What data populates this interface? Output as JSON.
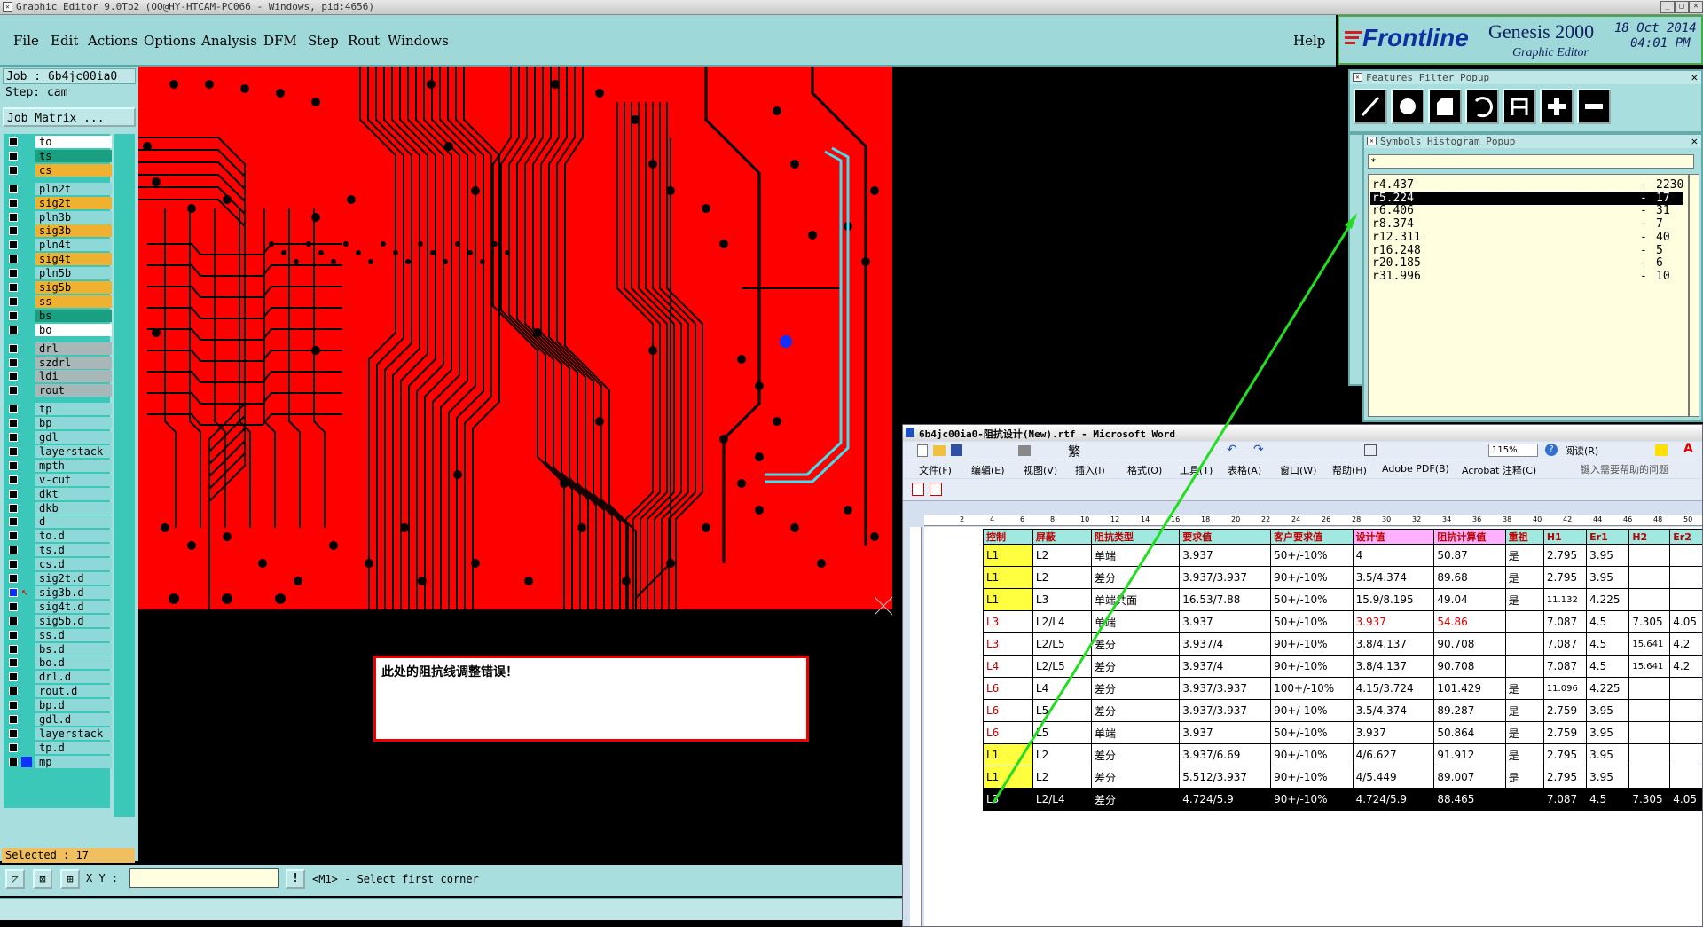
{
  "titlebar": {
    "title": "Graphic Editor 9.0Tb2  (OO@HY-HTCAM-PC066 - Windows, pid:4656)"
  },
  "menu": {
    "items": [
      "File",
      "Edit",
      "Actions",
      "Options",
      "Analysis",
      "DFM",
      "Step",
      "Rout",
      "Windows"
    ],
    "help": "Help"
  },
  "logo": {
    "brand": "Frontline",
    "product": "Genesis 2000",
    "subtitle": "Graphic Editor",
    "date": "18 Oct 2014",
    "time": "04:01 PM"
  },
  "job": {
    "job": "Job : 6b4jc00ia0",
    "step": "Step: cam",
    "matrix": "Job Matrix ..."
  },
  "layers": [
    {
      "name": "to",
      "color": "#ffffff"
    },
    {
      "name": "ts",
      "color": "#1aa080"
    },
    {
      "name": "cs",
      "color": "#f0b030"
    },
    {
      "name": "pln2t",
      "color": "#8ed8d8"
    },
    {
      "name": "sig2t",
      "color": "#f0b030"
    },
    {
      "name": "pln3b",
      "color": "#8ed8d8"
    },
    {
      "name": "sig3b",
      "color": "#f0b030"
    },
    {
      "name": "pln4t",
      "color": "#8ed8d8"
    },
    {
      "name": "sig4t",
      "color": "#f0b030"
    },
    {
      "name": "pln5b",
      "color": "#8ed8d8"
    },
    {
      "name": "sig5b",
      "color": "#f0b030"
    },
    {
      "name": "ss",
      "color": "#f0b030"
    },
    {
      "name": "bs",
      "color": "#1aa080"
    },
    {
      "name": "bo",
      "color": "#ffffff"
    },
    {
      "name": "drl",
      "color": "#a8b8b8"
    },
    {
      "name": "szdrl",
      "color": "#a8b8b8"
    },
    {
      "name": "ldi",
      "color": "#a8b8b8"
    },
    {
      "name": "rout",
      "color": "#a8b8b8"
    },
    {
      "name": "tp",
      "color": "#8ed8d8"
    },
    {
      "name": "bp",
      "color": "#8ed8d8"
    },
    {
      "name": "gdl",
      "color": "#8ed8d8"
    },
    {
      "name": "layerstack",
      "color": "#8ed8d8"
    },
    {
      "name": "mpth",
      "color": "#8ed8d8"
    },
    {
      "name": "v-cut",
      "color": "#8ed8d8"
    },
    {
      "name": "dkt",
      "color": "#8ed8d8"
    },
    {
      "name": "dkb",
      "color": "#8ed8d8"
    },
    {
      "name": "d",
      "color": "#8ed8d8"
    },
    {
      "name": "to.d",
      "color": "#8ed8d8"
    },
    {
      "name": "ts.d",
      "color": "#8ed8d8"
    },
    {
      "name": "cs.d",
      "color": "#8ed8d8"
    },
    {
      "name": "sig2t.d",
      "color": "#8ed8d8"
    },
    {
      "name": "sig3b.d",
      "color": "#8ed8d8"
    },
    {
      "name": "sig4t.d",
      "color": "#8ed8d8"
    },
    {
      "name": "sig5b.d",
      "color": "#8ed8d8"
    },
    {
      "name": "ss.d",
      "color": "#8ed8d8"
    },
    {
      "name": "bs.d",
      "color": "#8ed8d8"
    },
    {
      "name": "bo.d",
      "color": "#8ed8d8"
    },
    {
      "name": "drl.d",
      "color": "#8ed8d8"
    },
    {
      "name": "rout.d",
      "color": "#8ed8d8"
    },
    {
      "name": "bp.d",
      "color": "#8ed8d8"
    },
    {
      "name": "gdl.d",
      "color": "#8ed8d8"
    },
    {
      "name": "layerstack",
      "color": "#8ed8d8"
    },
    {
      "name": "tp.d",
      "color": "#8ed8d8"
    },
    {
      "name": "mp",
      "color": "#8ed8d8"
    }
  ],
  "selected": "Selected : 17",
  "annotation": "此处的阻抗线调整错误！",
  "bottom": {
    "xy_label": "X Y :",
    "xy_value": "",
    "hint": "<M1> - Select first corner"
  },
  "features_filter": {
    "title": "Features Filter Popup"
  },
  "histogram": {
    "title": "Symbols Histogram Popup",
    "filter": "*",
    "rows": [
      {
        "sym": "r4.437",
        "count": "2230"
      },
      {
        "sym": "r5.224",
        "count": "17"
      },
      {
        "sym": "r6.406",
        "count": "31"
      },
      {
        "sym": "r8.374",
        "count": "7"
      },
      {
        "sym": "r12.311",
        "count": "40"
      },
      {
        "sym": "r16.248",
        "count": "5"
      },
      {
        "sym": "r20.185",
        "count": "6"
      },
      {
        "sym": "r31.996",
        "count": "10"
      }
    ]
  },
  "word": {
    "title": "6b4jc00ia0-阻抗设计(New).rtf - Microsoft Word",
    "menus": [
      "文件(F)",
      "编辑(E)",
      "视图(V)",
      "插入(I)",
      "格式(O)",
      "工具(T)",
      "表格(A)",
      "窗口(W)",
      "帮助(H)",
      "Adobe PDF(B)",
      "Acrobat 注释(C)"
    ],
    "help_box": "键入需要帮助的问题",
    "zoom": "115%",
    "read_btn": "阅读(R)",
    "ruler": [
      "2",
      "4",
      "6",
      "8",
      "10",
      "12",
      "14",
      "16",
      "18",
      "20",
      "22",
      "24",
      "26",
      "28",
      "30",
      "32",
      "34",
      "36",
      "38",
      "40",
      "42",
      "44",
      "46",
      "48",
      "50"
    ],
    "headers": [
      "控制",
      "屏蔽",
      "阻抗类型",
      "要求值",
      "客户要求值",
      "设计值",
      "阻抗计算值",
      "重祖",
      "H1",
      "Er1",
      "H2",
      "Er2"
    ],
    "rows": [
      [
        "L1",
        "L2",
        "单端",
        "3.937",
        "50+/-10%",
        "4",
        "50.87",
        "是",
        "2.795",
        "3.95",
        "",
        ""
      ],
      [
        "L1",
        "L2",
        "差分",
        "3.937/3.937",
        "90+/-10%",
        "3.5/4.374",
        "89.68",
        "是",
        "2.795",
        "3.95",
        "",
        ""
      ],
      [
        "L1",
        "L3",
        "单端共面",
        "16.53/7.88",
        "50+/-10%",
        "15.9/8.195",
        "49.04",
        "是",
        "11.132",
        "4.225",
        "",
        ""
      ],
      [
        "L3",
        "L2/L4",
        "单端",
        "3.937",
        "50+/-10%",
        "3.937",
        "54.86",
        "",
        "7.087",
        "4.5",
        "7.305",
        "4.05"
      ],
      [
        "L3",
        "L2/L5",
        "差分",
        "3.937/4",
        "90+/-10%",
        "3.8/4.137",
        "90.708",
        "",
        "7.087",
        "4.5",
        "15.641",
        "4.2"
      ],
      [
        "L4",
        "L2/L5",
        "差分",
        "3.937/4",
        "90+/-10%",
        "3.8/4.137",
        "90.708",
        "",
        "7.087",
        "4.5",
        "15.641",
        "4.2"
      ],
      [
        "L6",
        "L4",
        "差分",
        "3.937/3.937",
        "100+/-10%",
        "4.15/3.724",
        "101.429",
        "是",
        "11.096",
        "4.225",
        "",
        ""
      ],
      [
        "L6",
        "L5",
        "差分",
        "3.937/3.937",
        "90+/-10%",
        "3.5/4.374",
        "89.287",
        "是",
        "2.759",
        "3.95",
        "",
        ""
      ],
      [
        "L6",
        "L5",
        "单端",
        "3.937",
        "50+/-10%",
        "3.937",
        "50.864",
        "是",
        "2.759",
        "3.95",
        "",
        ""
      ],
      [
        "L1",
        "L2",
        "差分",
        "3.937/6.69",
        "90+/-10%",
        "4/6.627",
        "91.912",
        "是",
        "2.795",
        "3.95",
        "",
        ""
      ],
      [
        "L1",
        "L2",
        "差分",
        "5.512/3.937",
        "90+/-10%",
        "4/5.449",
        "89.007",
        "是",
        "2.795",
        "3.95",
        "",
        ""
      ],
      [
        "L3",
        "L2/L4",
        "差分",
        "4.724/5.9",
        "90+/-10%",
        "4.724/5.9",
        "88.465",
        "",
        "7.087",
        "4.5",
        "7.305",
        "4.05"
      ]
    ]
  },
  "colors": {
    "pcb_red": "#ff0000",
    "trace": "#000000",
    "highlight": "#40e0f0",
    "arrow": "#22dd22",
    "panel": "#a8dede"
  }
}
